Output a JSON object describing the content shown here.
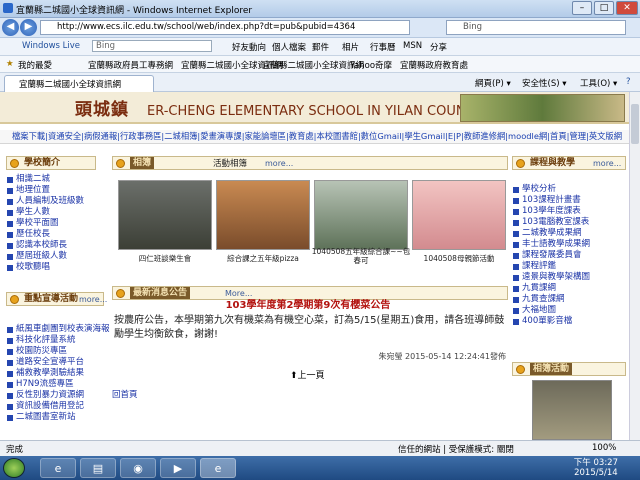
{
  "window": {
    "title": "宜蘭縣二城國小全球資訊網 - Windows Internet Explorer",
    "min": "–",
    "max": "□",
    "close": "✕"
  },
  "address": {
    "url": "http://www.ecs.ilc.edu.tw/school/web/index.php?dt=pub&pubid=4364",
    "search_placeholder": "Bing",
    "back": "◀",
    "forward": "▶"
  },
  "toolbar": {
    "live": "Windows Live",
    "bing": "Bing",
    "items": [
      "好友動向",
      "個人檔案",
      "郵件",
      "相片",
      "行事曆",
      "MSN",
      "分享"
    ]
  },
  "favorites": {
    "label": "我的最愛",
    "items": [
      "宜蘭縣政府員工專務網",
      "宜蘭縣二城國小全球資訊網",
      "宜蘭縣二城國小全球資訊網",
      "Yahoo奇摩",
      "宜蘭縣政府教育處"
    ]
  },
  "tab": {
    "label": "宜蘭縣二城國小全球資訊網",
    "page": "網頁(P) ▾",
    "safety": "安全性(S) ▾",
    "tools": "工具(O) ▾",
    "help": "?"
  },
  "banner": {
    "name": "頭城鎮",
    "english": "ER-CHENG ELEMENTARY SCHOOL IN YILAN COUNTY"
  },
  "linkbar": "檔案下載|資通安全|病假通報|行政事務區|二城相簿|愛畫演專課|家能論壇區|教育處|本校圖書館|數位Gmail|學生Gmail|E|P|教師進修網|moodle網|首頁|管理|英文版網",
  "left": {
    "section1": "學校簡介",
    "items1": [
      "相識二城",
      "地理位置",
      "人員編制及班級數",
      "學生人數",
      "學校平面圖",
      "歷任校長",
      "認識本校師長",
      "歷屆班級人數",
      "校歌聽唱"
    ],
    "section2": "重點宣導活動",
    "more": "more...",
    "items2": [
      "紙風車劇團到校表演海報",
      "科技化評量系統",
      "校園防災專區",
      "道路安全宣導平台",
      "補救教學測驗結果",
      "H7N9流感專區",
      "反性別暴力資源網",
      "資訊設備借用登記",
      "二城圖書室新站"
    ]
  },
  "center": {
    "album_title": "相簿",
    "album_sub": "活動相簿",
    "more": "more...",
    "photos": [
      {
        "cap": "四仁班談樂生會"
      },
      {
        "cap": "綜合課之五年級pizza"
      },
      {
        "cap": "1040508五年級綜合課~~包春可"
      },
      {
        "cap": "1040508母親節活動"
      }
    ],
    "news_title": "最新消息公告",
    "news_more": "More...",
    "notice_title": "103學年度第2學期第9次有櫻菜公告",
    "notice_body": "按農府公告，本學期第九次有機菜為有機空心菜，訂為5/15(星期五)食用，請各班導師鼓勵學生均衡飲食，謝謝!",
    "notice_footer": "朱宛瑩  2015-05-14 12:24:41發佈",
    "prev": "上一頁",
    "home": "回首頁"
  },
  "right": {
    "section": "課程與教學",
    "more": "more...",
    "items": [
      "學校分析",
      "103課程計畫書",
      "103學年度課表",
      "103電腦教室課表",
      "二城教學成果網",
      "丰士語教學成果網",
      "課程發展委員會",
      "課程評鑑",
      "遠景與教學架構圖",
      "九貫課綱",
      "九貫查課網",
      "大福地圖",
      "400單影音檔"
    ],
    "photo_section": "相簿活動"
  },
  "status": {
    "left": "完成",
    "zone": "信任的網站 | 受保護模式: 關閉",
    "zoom": "100%"
  },
  "clock": {
    "time": "下午 03:27",
    "date": "2015/5/14"
  }
}
